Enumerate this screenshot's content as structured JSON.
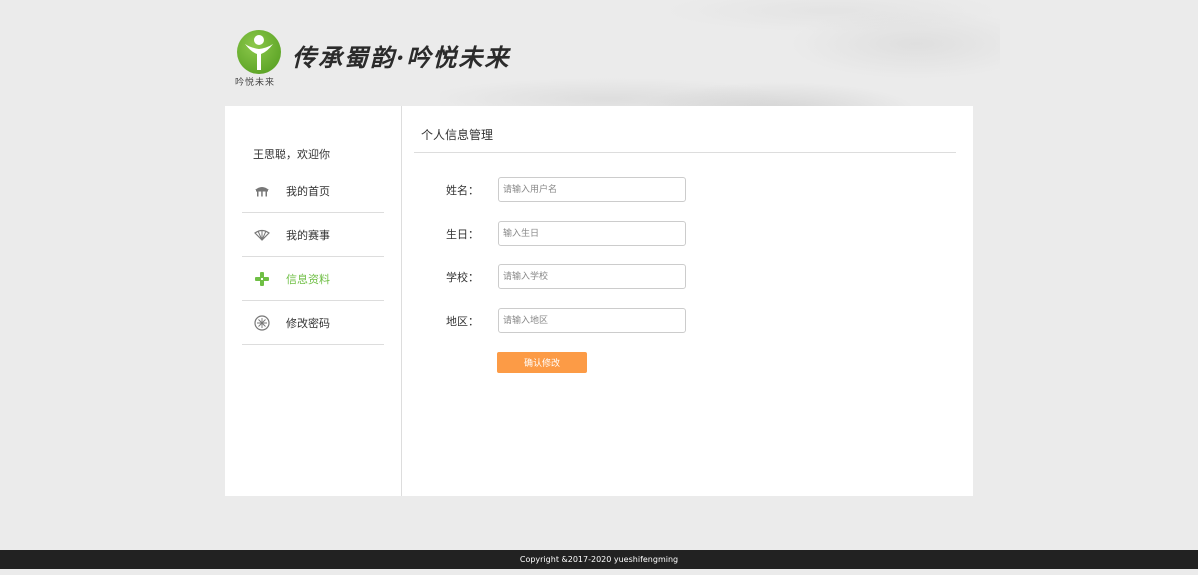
{
  "header": {
    "slogan": "传承蜀韵·吟悦未来",
    "logo_subtitle": "吟悦未来",
    "brand_color": "#5aa625"
  },
  "sidebar": {
    "welcome": "王思聪，欢迎你",
    "items": [
      {
        "label": "我的首页",
        "icon": "pavilion-icon",
        "active": false
      },
      {
        "label": "我的赛事",
        "icon": "fan-icon",
        "active": false
      },
      {
        "label": "信息资料",
        "icon": "scroll-icon",
        "active": true
      },
      {
        "label": "修改密码",
        "icon": "lattice-icon",
        "active": false
      }
    ],
    "active_color": "#6fbf45"
  },
  "main": {
    "title": "个人信息管理",
    "fields": [
      {
        "label": "姓名：",
        "placeholder": "请输入用户名",
        "value": ""
      },
      {
        "label": "生日：",
        "placeholder": "输入生日",
        "value": ""
      },
      {
        "label": "学校：",
        "placeholder": "请输入学校",
        "value": ""
      },
      {
        "label": "地区：",
        "placeholder": "请输入地区",
        "value": ""
      }
    ],
    "confirm_label": "确认修改",
    "confirm_color": "#fc9b46"
  },
  "footer": {
    "copyright": "Copyright &2017-2020 yueshifengming"
  }
}
